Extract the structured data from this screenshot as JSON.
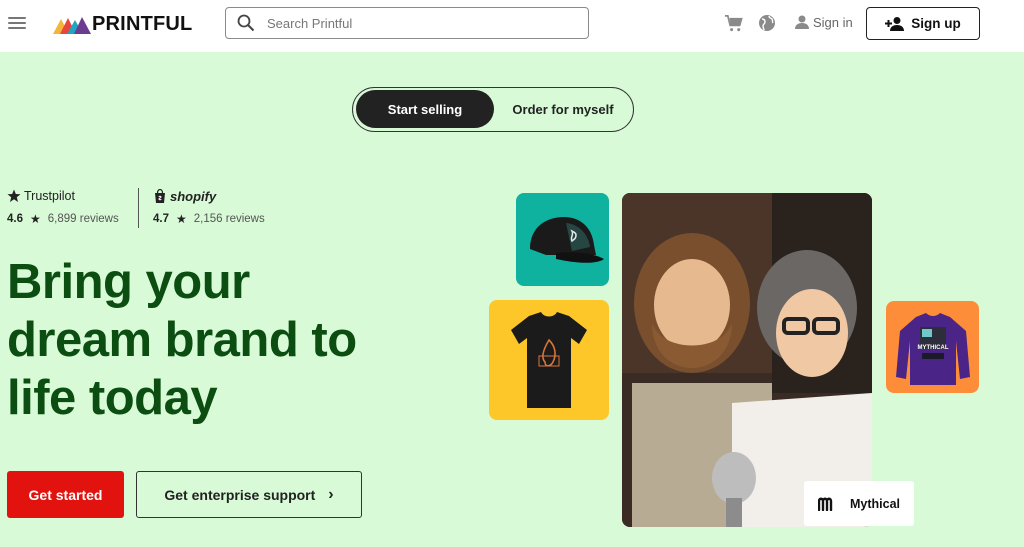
{
  "header": {
    "logo_text": "PRINTFUL",
    "search_placeholder": "Search Printful",
    "signin_label": "Sign in",
    "signup_label": "Sign up"
  },
  "toggle": {
    "active_label": "Start selling",
    "inactive_label": "Order for myself"
  },
  "ratings": {
    "trustpilot": {
      "brand": "Trustpilot",
      "score": "4.6",
      "reviews": "6,899 reviews"
    },
    "shopify": {
      "brand": "shopify",
      "score": "4.7",
      "reviews": "2,156 reviews"
    }
  },
  "hero": {
    "headline_lines": [
      "Bring your",
      "dream brand to",
      "life today"
    ],
    "primary_cta": "Get started",
    "secondary_cta": "Get enterprise support"
  },
  "featured": {
    "brand_name": "Mythical",
    "sweatshirt_print": "MYTHICAL"
  },
  "colors": {
    "background": "#d8fad7",
    "headline": "#0c4d12",
    "primary_cta": "#e2130f",
    "hat_tile": "#0fb19f",
    "tee_tile": "#fdc729",
    "sweat_tile": "#fe8d3a"
  },
  "icons": [
    "menu-icon",
    "search-icon",
    "cart-icon",
    "globe-icon",
    "user-icon",
    "add-user-icon",
    "star-icon",
    "shopify-bag-icon",
    "chevron-right-icon",
    "mythical-logo-icon"
  ]
}
